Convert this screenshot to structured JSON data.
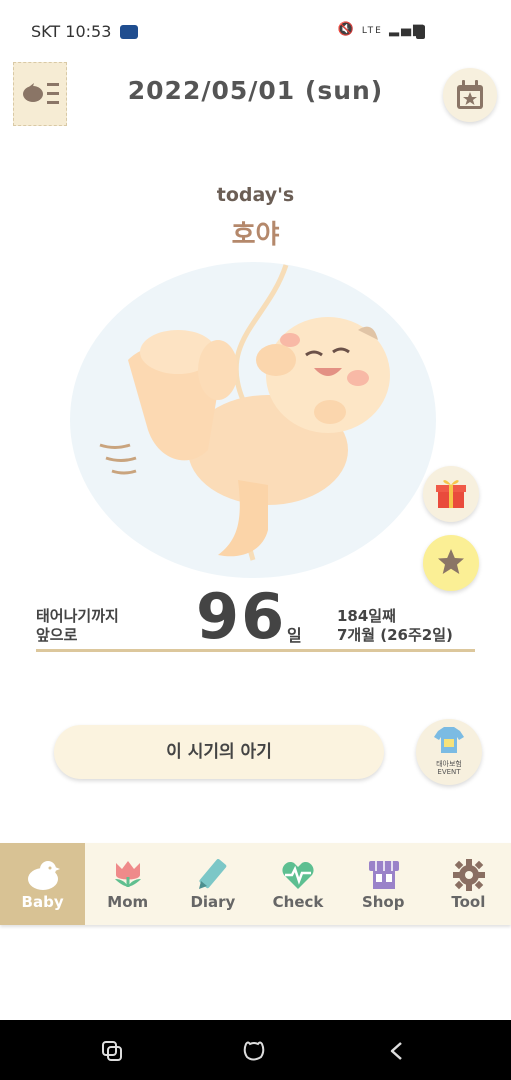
{
  "status_bar": {
    "carrier": "SKT",
    "time": "10:53",
    "network": "LTE"
  },
  "header": {
    "date": "2022/05/01 (sun)"
  },
  "today": {
    "label": "today's",
    "name": "호야"
  },
  "dday": {
    "left_line1": "태어나기까지",
    "left_line2": "앞으로",
    "number": "96",
    "unit": "일",
    "right_line1": "184일째",
    "right_line2": "7개월 (26주2일)"
  },
  "period_button_label": "이 시기의 아기",
  "event": {
    "line1": "태아보험",
    "line2": "EVENT"
  },
  "tabs": [
    {
      "label": "Baby",
      "icon": "bird-icon"
    },
    {
      "label": "Mom",
      "icon": "tulip-icon"
    },
    {
      "label": "Diary",
      "icon": "pencil-icon"
    },
    {
      "label": "Check",
      "icon": "heart-pulse-icon"
    },
    {
      "label": "Shop",
      "icon": "store-icon"
    },
    {
      "label": "Tool",
      "icon": "gear-icon"
    }
  ],
  "colors": {
    "accent": "#d8c294",
    "tab_bg": "#faf5e6",
    "name": "#b4886b",
    "star_bg": "#fbef95"
  }
}
